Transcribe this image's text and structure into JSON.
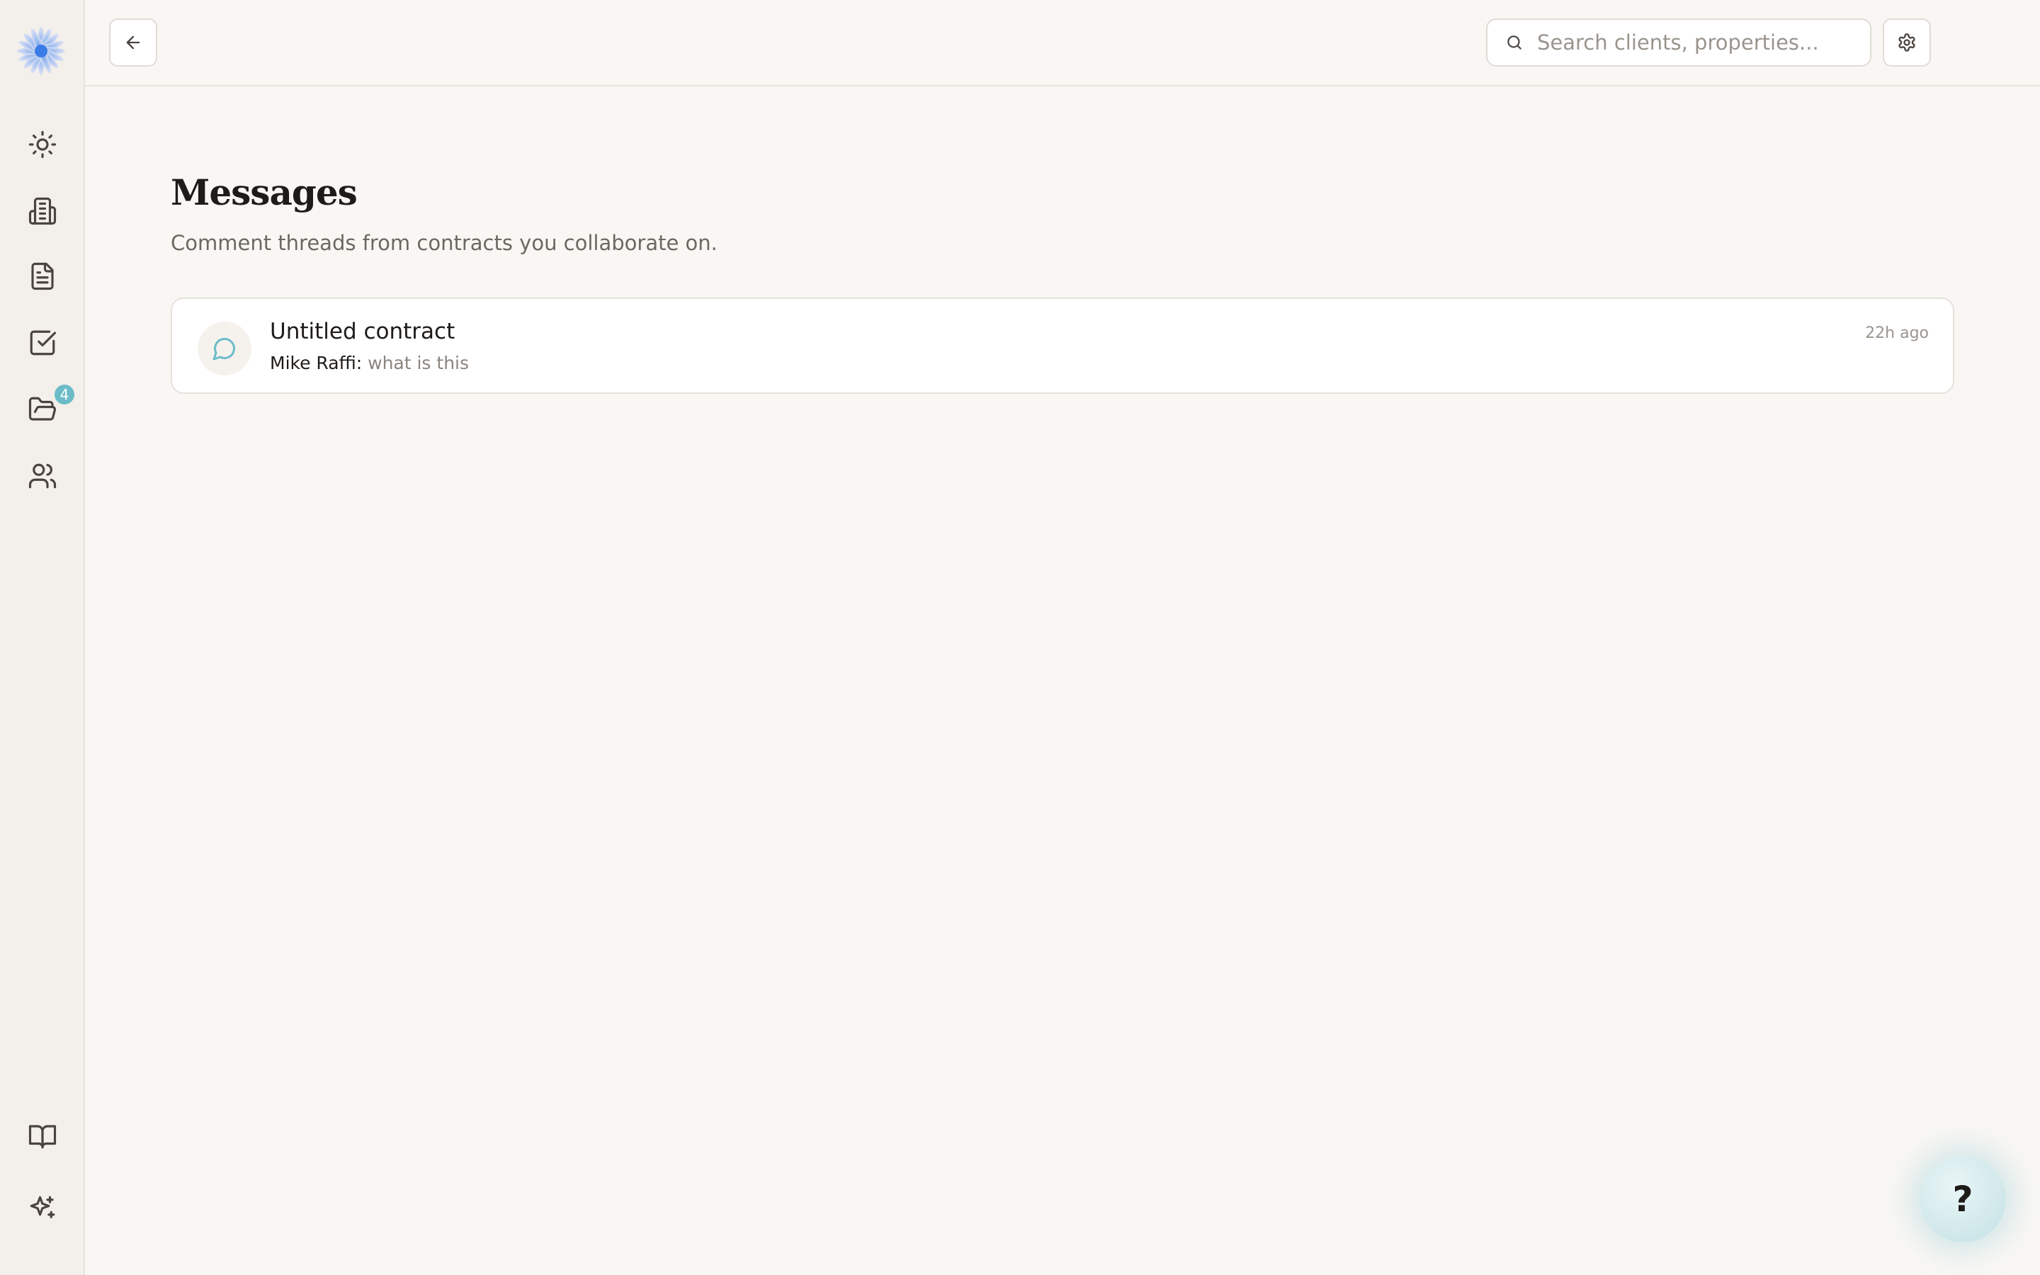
{
  "sidebar": {
    "items": [
      {
        "name": "sun-icon"
      },
      {
        "name": "building-icon"
      },
      {
        "name": "document-icon"
      },
      {
        "name": "checkbox-icon"
      },
      {
        "name": "folder-open-icon",
        "badge": "4"
      },
      {
        "name": "users-icon"
      }
    ],
    "bottom_items": [
      {
        "name": "book-icon"
      },
      {
        "name": "sparkles-icon"
      }
    ]
  },
  "topbar": {
    "search_placeholder": "Search clients, properties..."
  },
  "main": {
    "title": "Messages",
    "subtitle": "Comment threads from contracts you collaborate on.",
    "threads": [
      {
        "title": "Untitled contract",
        "author": "Mike Raffi:",
        "message": "what is this",
        "time": "22h ago"
      }
    ]
  },
  "help": {
    "label": "?"
  },
  "colors": {
    "accent": "#6cbcc8",
    "background": "#f9f7f4",
    "sidebar": "#f3efea"
  }
}
